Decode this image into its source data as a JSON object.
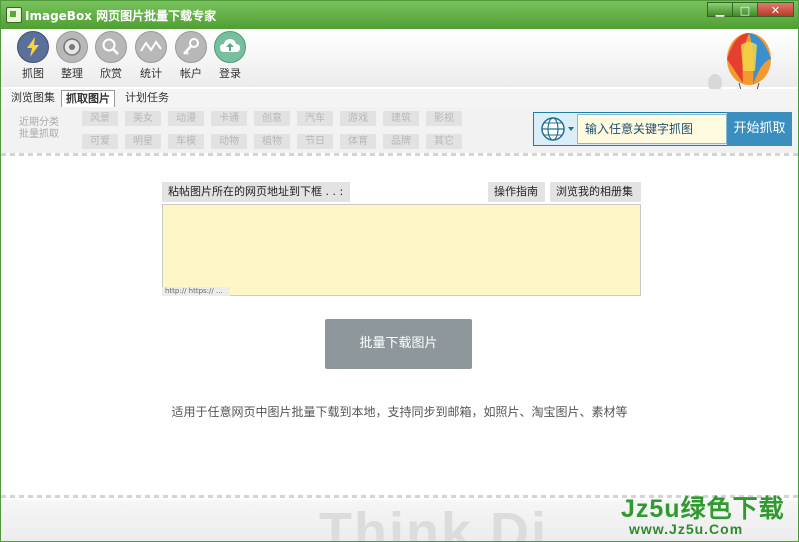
{
  "window": {
    "title": "ImageBox 网页图片批量下载专家",
    "controls": {
      "minimize": "▁",
      "maximize": "□",
      "close": "✕"
    }
  },
  "toolbar": {
    "items": [
      {
        "label": "抓图",
        "icon": "lightning-icon"
      },
      {
        "label": "整理",
        "icon": "disc-icon"
      },
      {
        "label": "欣赏",
        "icon": "magnifier-icon"
      },
      {
        "label": "统计",
        "icon": "chart-wave-icon"
      },
      {
        "label": "帐户",
        "icon": "key-icon"
      },
      {
        "label": "登录",
        "icon": "cloud-upload-icon"
      }
    ]
  },
  "tabs": [
    "浏览图集",
    "抓取图片",
    "计划任务"
  ],
  "categories": {
    "label_line1": "近期分类",
    "label_line2": "批量抓取",
    "row1": [
      "风景",
      "美女",
      "动漫",
      "卡通",
      "创意",
      "汽车",
      "游戏",
      "建筑",
      "影视"
    ],
    "row2": [
      "可爱",
      "明星",
      "车模",
      "动物",
      "植物",
      "节日",
      "体育",
      "品牌",
      "其它"
    ]
  },
  "search": {
    "placeholder": "输入任意关键字抓图",
    "button": "开始抓取"
  },
  "paste": {
    "label": "粘帖图片所在的网页地址到下框  . . :",
    "guide_button": "操作指南",
    "album_button": "浏览我的相册集",
    "hint": "http:// https:// ..."
  },
  "batch_button": "批量下载图片",
  "description": "适用于任意网页中图片批量下载到本地，支持同步到邮箱，如照片、淘宝图片、素材等",
  "footer": {
    "background_text": "Think Di",
    "watermark_title": "Jz5u绿色下载",
    "watermark_url": "www.Jz5u.Com"
  },
  "colors": {
    "titlebar": "#4f9f34",
    "accent": "#3a8fbf",
    "url_field": "#fff6c8"
  }
}
